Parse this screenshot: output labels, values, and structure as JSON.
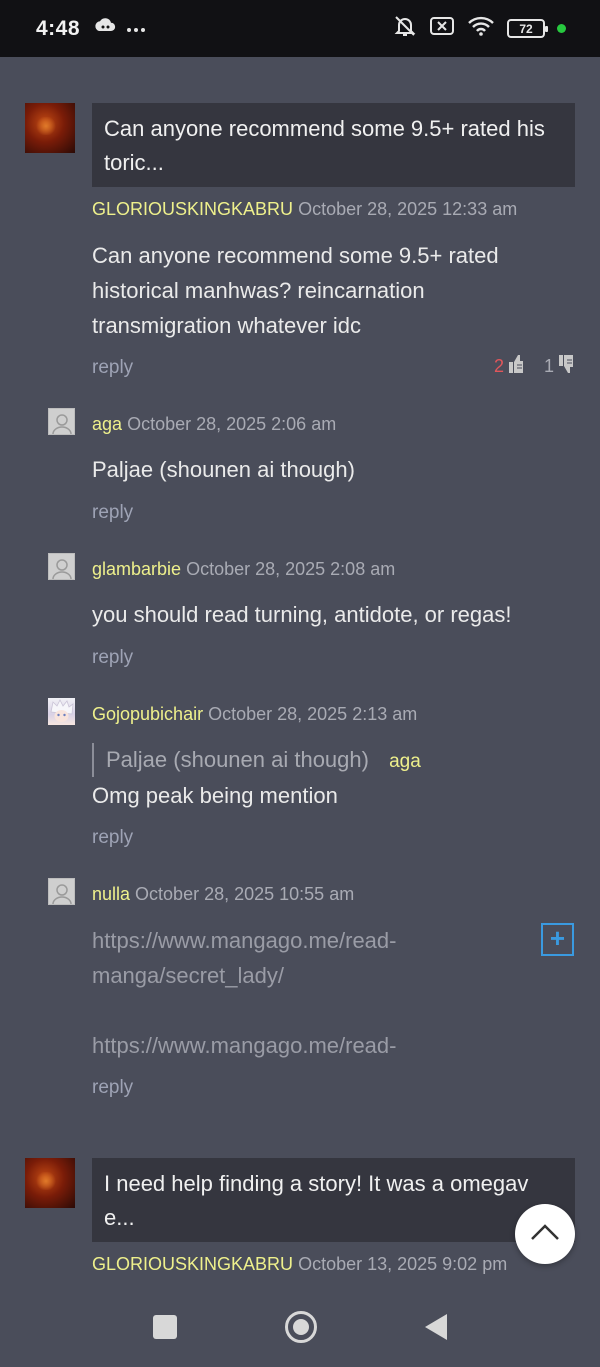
{
  "status_bar": {
    "time": "4:48",
    "battery": "72",
    "icons": [
      "cloud-game-icon",
      "more-dots-icon",
      "bell-muted-icon",
      "sim-off-icon",
      "wifi-icon",
      "battery-icon",
      "active-dot-icon"
    ],
    "colors": {
      "background": "#111114",
      "active_dot": "#27c93f"
    }
  },
  "threads": [
    {
      "title": "Can anyone recommend some 9.5+ rated historical manhwas? reincarnation transmigration whatever idc",
      "title_display": "Can anyone recommend some 9.5+ rated his toric...",
      "title_line1": "Can anyone recommend some 9.5+ rated his",
      "title_line2": "toric...",
      "username": "GLORIOUSKINGKABRU",
      "date": "October 28, 2025 12:33 am",
      "body_line1": "Can anyone recommend some 9.5+ rated",
      "body_line2": "historical manhwas? reincarnation",
      "body_line3": "transmigration whatever idc",
      "reply_label": "reply",
      "upvotes": "2",
      "downvotes": "1",
      "replies": [
        {
          "username": "aga",
          "date": "October 28, 2025 2:06 am",
          "body": "Paljae (shounen ai though)",
          "reply_label": "reply"
        },
        {
          "username": "glambarbie",
          "date": "October 28, 2025 2:08 am",
          "body": "you should read turning, antidote, or regas!",
          "reply_label": "reply"
        },
        {
          "username": "Gojopubichair",
          "date": "October 28, 2025 2:13 am",
          "quote_text": "Paljae (shounen ai though)",
          "quote_user": "aga",
          "body": "Omg peak being mention",
          "reply_label": "reply"
        },
        {
          "username": "nulla",
          "date": "October 28, 2025 10:55 am",
          "link1_line1": "https://www.mangago.me/read-",
          "link1_line2": "manga/secret_lady/",
          "link2_line1": "https://www.mangago.me/read-",
          "expand_label": "+",
          "reply_label": "reply"
        }
      ]
    },
    {
      "title_display": "I need help finding a story! It was a omegav e...",
      "title_line1": "I need help finding a story! It was a omegav",
      "title_line2": "e...",
      "username": "GLORIOUSKINGKABRU",
      "date": "October 13, 2025 9:02 pm"
    }
  ],
  "colors": {
    "page_background": "#4a4d5a",
    "title_box": "#35363f",
    "username": "#eef08c",
    "reply": "#9ea3b5",
    "upvote": "#e0565b",
    "expand_button": "#3a9ae0"
  },
  "nav": {
    "icons": [
      "recents-square-icon",
      "home-circle-icon",
      "back-triangle-icon"
    ]
  }
}
